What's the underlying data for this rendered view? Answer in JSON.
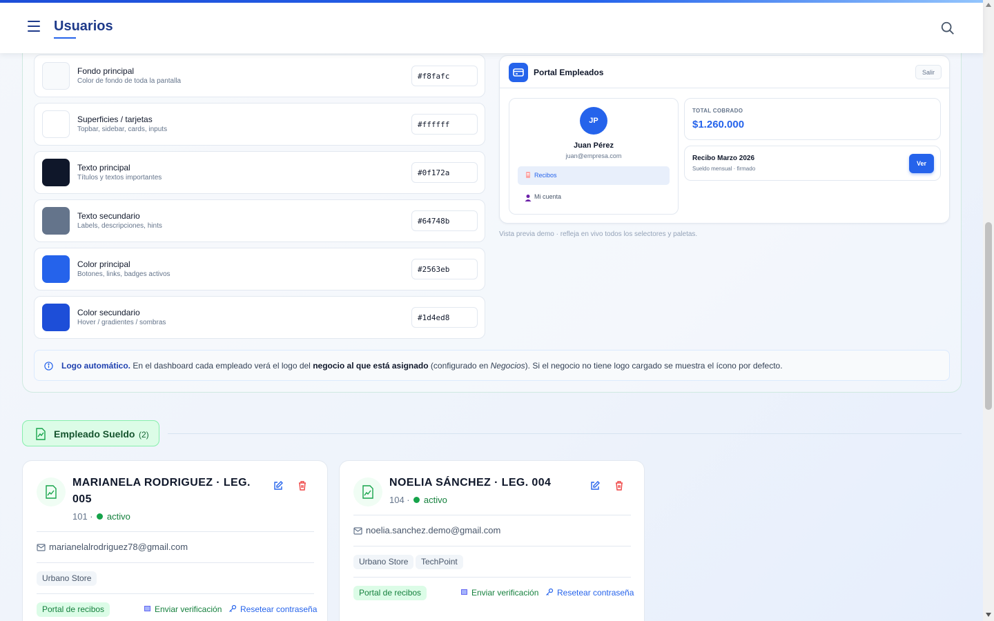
{
  "header": {
    "title": "Usuarios"
  },
  "colors": [
    {
      "label": "Fondo principal",
      "desc": "Color de fondo de toda la pantalla",
      "value": "#f8fafc"
    },
    {
      "label": "Superficies / tarjetas",
      "desc": "Topbar, sidebar, cards, inputs",
      "value": "#ffffff"
    },
    {
      "label": "Texto principal",
      "desc": "Títulos y textos importantes",
      "value": "#0f172a"
    },
    {
      "label": "Texto secundario",
      "desc": "Labels, descripciones, hints",
      "value": "#64748b"
    },
    {
      "label": "Color principal",
      "desc": "Botones, links, badges activos",
      "value": "#2563eb"
    },
    {
      "label": "Color secundario",
      "desc": "Hover / gradientes / sombras",
      "value": "#1d4ed8"
    }
  ],
  "preview": {
    "title": "Portal Empleados",
    "logout": "Salir",
    "avatar": "JP",
    "name": "Juan Pérez",
    "email": "juan@empresa.com",
    "nav_recibos": "Recibos",
    "nav_cuenta": "Mi cuenta",
    "total_label": "TOTAL COBRADO",
    "total_value": "$1.260.000",
    "receipt_title": "Recibo Marzo 2026",
    "receipt_sub": "Sueldo mensual · firmado",
    "view_button": "Ver",
    "caption": "Vista previa demo · refleja en vivo todos los selectores y paletas."
  },
  "info": {
    "lead": "Logo automático.",
    "t1": " En el dashboard cada empleado verá el logo del ",
    "bold": "negocio al que está asignado",
    "t2": " (configurado en ",
    "italic": "Negocios",
    "t3": "). Si el negocio no tiene logo cargado se muestra el ícono por defecto."
  },
  "group": {
    "label": "Empleado Sueldo",
    "count": "(2)"
  },
  "users": [
    {
      "name": "MARIANELA RODRIGUEZ · LEG. 005",
      "code": "101 · ",
      "status": "activo",
      "email": "marianelalrodriguez78@gmail.com",
      "tags": [
        "Urbano Store"
      ],
      "portal": "Portal de recibos",
      "verify": "Enviar verificación",
      "reset": "Resetear contraseña"
    },
    {
      "name": "NOELIA SÁNCHEZ · LEG. 004",
      "code": "104 · ",
      "status": "activo",
      "email": "noelia.sanchez.demo@gmail.com",
      "tags": [
        "Urbano Store",
        "TechPoint"
      ],
      "portal": "Portal de recibos",
      "verify": "Enviar verificación",
      "reset": "Resetear contraseña"
    }
  ]
}
